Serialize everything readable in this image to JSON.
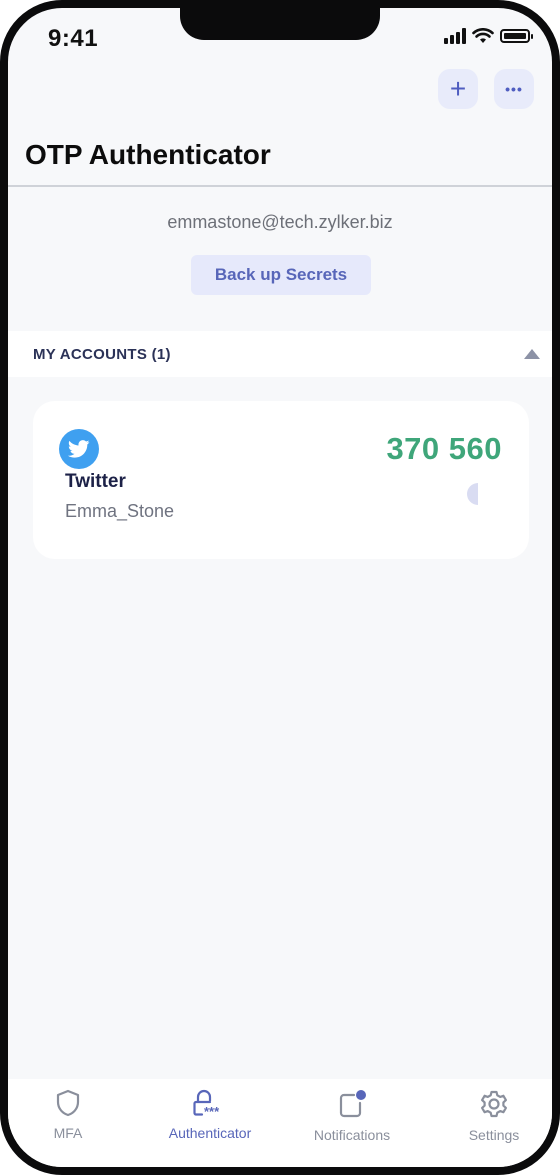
{
  "status_bar": {
    "time": "9:41"
  },
  "header": {
    "add_button": "+",
    "more_button": "•••",
    "title": "OTP Authenticator"
  },
  "user": {
    "email": "emmastone@tech.zylker.biz",
    "backup_label": "Back up Secrets"
  },
  "accounts_section": {
    "label": "MY ACCOUNTS  (1)"
  },
  "accounts": [
    {
      "service": "Twitter",
      "username": "Emma_Stone",
      "code": "370 560",
      "icon": "twitter-icon",
      "remaining_fraction": 0.5
    }
  ],
  "tabs": [
    {
      "label": "MFA",
      "icon": "shield-icon",
      "active": false
    },
    {
      "label": "Authenticator",
      "icon": "lock-icon",
      "active": true
    },
    {
      "label": "Notifications",
      "icon": "notification-icon",
      "active": false
    },
    {
      "label": "Settings",
      "icon": "gear-icon",
      "active": false
    }
  ],
  "colors": {
    "accent": "#5866b9",
    "otp_green": "#3fa67a",
    "twitter_blue": "#3fa0f0",
    "background": "#f7f8fa"
  }
}
